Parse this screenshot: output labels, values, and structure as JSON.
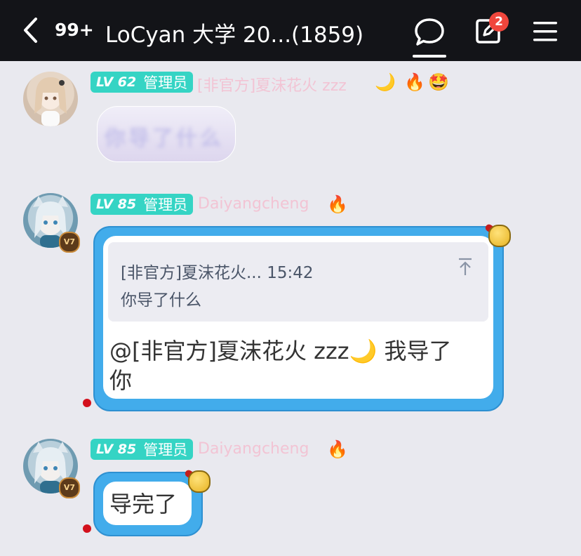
{
  "header": {
    "unread_count": "99+",
    "title": "LoCyan 大学 20...(1859)",
    "notification_badge": "2",
    "icons": [
      "back-arrow-icon",
      "chat-bubble-icon",
      "edit-compose-icon",
      "menu-icon"
    ]
  },
  "messages": [
    {
      "level": "LV 62",
      "role": "管理员",
      "nickname": "[非官方]夏沫花火 zzz",
      "decorations": [
        "🌙",
        "🔥",
        "🤩"
      ],
      "content": "你导了什么",
      "content_blurred": true,
      "avatar_badge": ""
    },
    {
      "level": "LV 85",
      "role": "管理员",
      "nickname": "Daiyangcheng",
      "decorations": [
        "🔥"
      ],
      "avatar_badge": "V7",
      "quote": {
        "author": "[非官方]夏沫花火...",
        "time": "15:42",
        "text": "你导了什么"
      },
      "text_line1": "@[非官方]夏沫花火 zzz🌙 我导了",
      "text_line2": "你"
    },
    {
      "level": "LV 85",
      "role": "管理员",
      "nickname": "Daiyangcheng",
      "decorations": [
        "🔥"
      ],
      "avatar_badge": "V7",
      "text": "导完了"
    }
  ],
  "colors": {
    "header_bg": "#131418",
    "page_bg": "#e9e9ef",
    "level_tag": "#35d4c4",
    "bubble_frame": "#42aceb",
    "badge": "#f0463c",
    "nickname": "#f2c4d4"
  }
}
